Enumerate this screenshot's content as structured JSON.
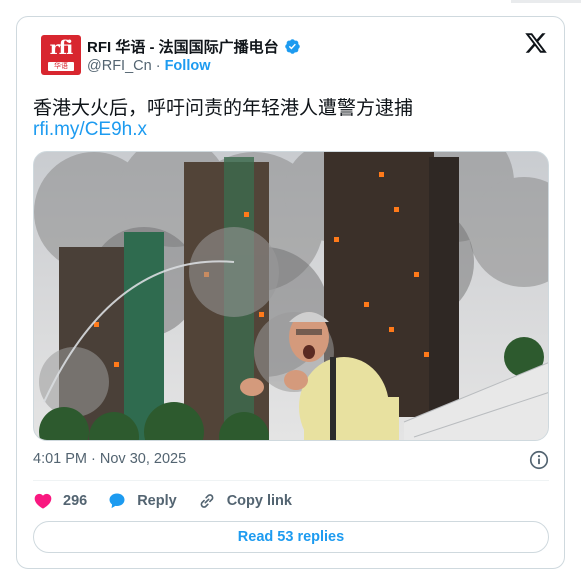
{
  "header": {
    "logo_text": "rfi",
    "logo_sub": "华语",
    "display_name": "RFI 华语 - 法国国际广播电台",
    "handle": "@RFI_Cn",
    "separator": " · ",
    "follow_label": "Follow"
  },
  "tweet": {
    "text": "香港大火后，呼吁问责的年轻港人遭警方逮捕",
    "link": "rfi.my/CE9h.x"
  },
  "meta": {
    "timestamp": "4:01 PM · Nov 30, 2025"
  },
  "actions": {
    "like_count": "296",
    "reply_label": "Reply",
    "copy_link_label": "Copy link"
  },
  "replies_button": "Read 53 replies",
  "colors": {
    "accent": "#1d9bf0",
    "like": "#f91880",
    "brand_red": "#d8262f",
    "muted": "#536471"
  },
  "icons": [
    "verified-badge-icon",
    "x-logo-icon",
    "info-icon",
    "heart-icon",
    "reply-bubble-icon",
    "link-icon"
  ]
}
